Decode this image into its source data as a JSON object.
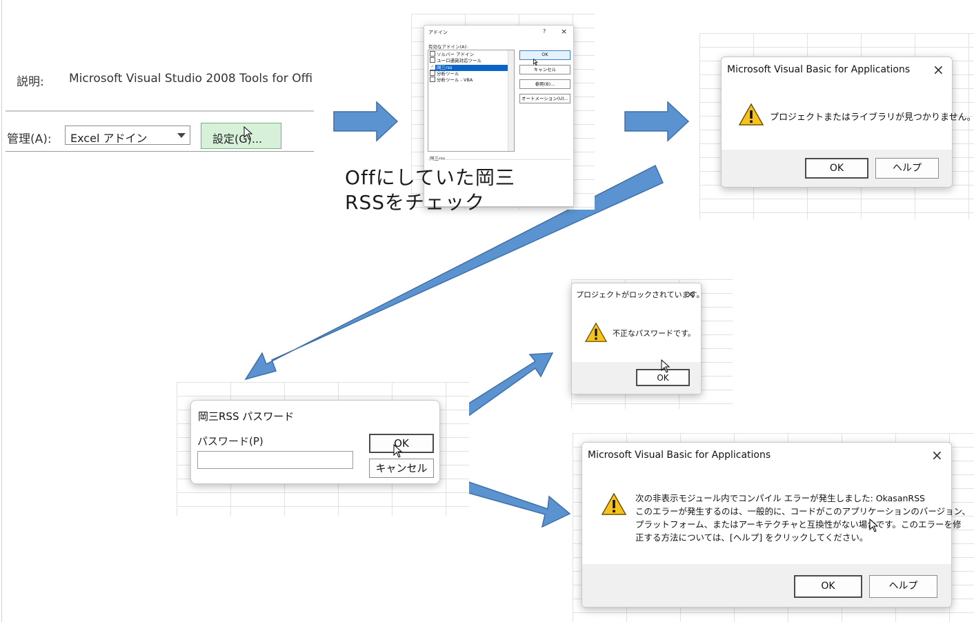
{
  "addin_manager": {
    "description_label": "説明:",
    "description_value": "Microsoft Visual Studio 2008 Tools for Offi",
    "manage_label": "管理(A):",
    "manage_select_value": "Excel アドイン",
    "settings_button": "設定(G)..."
  },
  "addins_dialog": {
    "title": "アドイン",
    "help_glyph": "?",
    "close_glyph": "×",
    "list_label": "有効なアドイン(A):",
    "items": [
      {
        "label": "ソルバー アドイン",
        "checked": false
      },
      {
        "label": "ユーロ通貨対応ツール",
        "checked": false
      },
      {
        "label": "岡三rss",
        "checked": true
      },
      {
        "label": "分析ツール",
        "checked": false
      },
      {
        "label": "分析ツール - VBA",
        "checked": false
      }
    ],
    "buttons": {
      "ok": "OK",
      "cancel": "キャンセル",
      "browse": "参照(B)...",
      "automation": "オートメーション(U)..."
    },
    "selected_name": "岡三rss"
  },
  "annotation": {
    "line1": "Offにしていた岡三",
    "line2": "RSSをチェック"
  },
  "vba_error_1": {
    "title": "Microsoft Visual Basic for Applications",
    "message": "プロジェクトまたはライブラリが見つかりません。",
    "ok": "OK",
    "help": "ヘルプ",
    "close_glyph": "×"
  },
  "password_dialog": {
    "title": "岡三RSS パスワード",
    "field_label": "パスワード(P)",
    "field_value": "",
    "ok": "OK",
    "cancel": "キャンセル"
  },
  "locked_dialog": {
    "title": "プロジェクトがロックされています。",
    "message": "不正なパスワードです。",
    "ok": "OK",
    "close_glyph": "×"
  },
  "vba_error_2": {
    "title": "Microsoft Visual Basic for Applications",
    "lines": [
      "次の非表示モジュール内でコンパイル エラーが発生しました: OkasanRSS",
      "このエラーが発生するのは、一般的に、コードがこのアプリケーションのバージョン、",
      "プラットフォーム、またはアーキテクチャと互換性がない場合です。このエラーを修",
      "正する方法については、[ヘルプ] をクリックしてください。"
    ],
    "ok": "OK",
    "help": "ヘルプ",
    "close_glyph": "×"
  },
  "colors": {
    "arrow": "#5b93d0",
    "arrow_stroke": "#3e6fa8",
    "selection": "#0a64c8",
    "settings_bg": "#d6f0da"
  }
}
